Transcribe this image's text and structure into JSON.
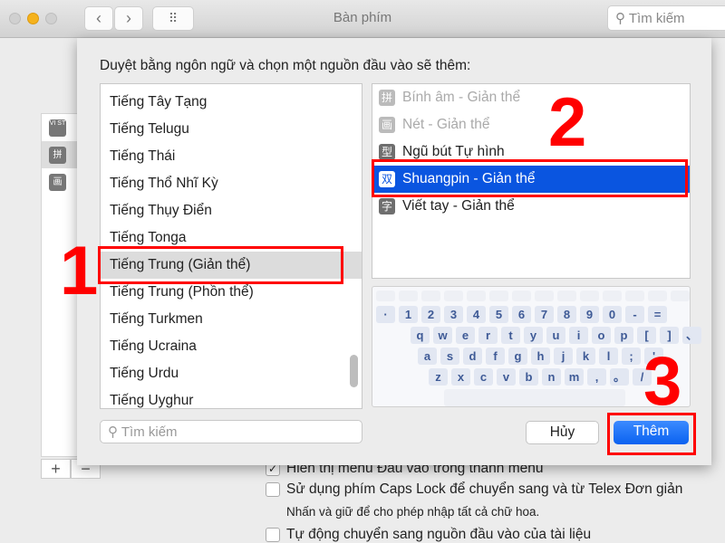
{
  "window": {
    "title": "Bàn phím",
    "search_placeholder": "Tìm kiếm",
    "back": "‹",
    "forward": "›",
    "grid": "⠿"
  },
  "background": {
    "sources": [
      {
        "icon": "VI ST"
      },
      {
        "icon": "拼"
      },
      {
        "icon": "画"
      }
    ],
    "add": "+",
    "remove": "−",
    "options": [
      {
        "label": "Hiển thị menu Đầu vào trong thanh menu",
        "checked": true
      },
      {
        "label": "Sử dụng phím Caps Lock để chuyển sang và từ Telex Đơn giản",
        "checked": false
      },
      {
        "label": "Tự động chuyển sang nguồn đầu vào của tài liệu",
        "checked": false
      }
    ],
    "caps_hint": "Nhấn và giữ để cho phép nhập tất cả chữ hoa."
  },
  "sheet": {
    "prompt": "Duyệt bằng ngôn ngữ và chọn một nguồn đầu vào sẽ thêm:",
    "languages": [
      "Tiếng Tây Tạng",
      "Tiếng Telugu",
      "Tiếng Thái",
      "Tiếng Thổ Nhĩ Kỳ",
      "Tiếng Thụy Điển",
      "Tiếng Tonga",
      "Tiếng Trung (Giản thể)",
      "Tiếng Trung (Phồn thể)",
      "Tiếng Turkmen",
      "Tiếng Ucraina",
      "Tiếng Urdu",
      "Tiếng Uyghur"
    ],
    "selected_language": "Tiếng Trung (Giản thể)",
    "input_sources": [
      {
        "label": "Bính âm - Giản thể",
        "icon": "拼",
        "state": "disabled"
      },
      {
        "label": "Nét - Giản thể",
        "icon": "画",
        "state": "disabled"
      },
      {
        "label": "Ngũ bút Tự hình",
        "icon": "型",
        "state": "normal"
      },
      {
        "label": "Shuangpin - Giản thể",
        "icon": "双",
        "state": "selected"
      },
      {
        "label": "Viết tay - Giản thể",
        "icon": "字",
        "state": "normal"
      }
    ],
    "keyboard": [
      [
        "·",
        "1",
        "2",
        "3",
        "4",
        "5",
        "6",
        "7",
        "8",
        "9",
        "0",
        "-",
        "="
      ],
      [
        "q",
        "w",
        "e",
        "r",
        "t",
        "y",
        "u",
        "i",
        "o",
        "p",
        "[",
        "]",
        "、"
      ],
      [
        "a",
        "s",
        "d",
        "f",
        "g",
        "h",
        "j",
        "k",
        "l",
        ";",
        "'"
      ],
      [
        "z",
        "x",
        "c",
        "v",
        "b",
        "n",
        "m",
        ",",
        "。",
        "/"
      ]
    ],
    "search_placeholder": "Tìm kiếm",
    "cancel": "Hủy",
    "add": "Thêm",
    "accent": "#0a55e0"
  },
  "annotations": {
    "step1": "1",
    "step2": "2",
    "step3": "3",
    "color": "#ff0000"
  }
}
